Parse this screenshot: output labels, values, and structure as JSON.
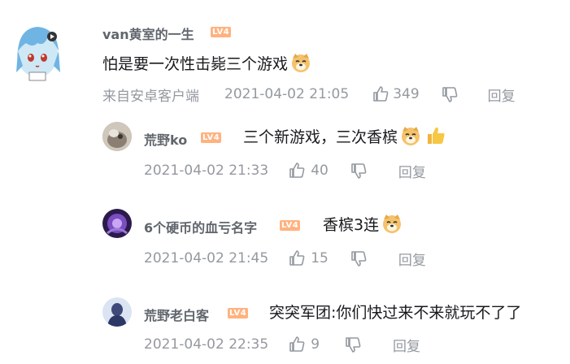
{
  "level_badge": "LV4",
  "main_comment": {
    "username": "van黄室的一生",
    "text": "怕是要一次性击毙三个游戏",
    "source": "来自安卓客户端",
    "time": "2021-04-02 21:05",
    "likes": "349",
    "reply_label": "回复",
    "emoji_icon": "doge-emoji"
  },
  "replies": [
    {
      "username": "荒野ko",
      "text": "三个新游戏，三次香槟",
      "time": "2021-04-02 21:33",
      "likes": "40",
      "reply_label": "回复",
      "emoji_icons": [
        "doge-emoji",
        "thumbs-up-emoji"
      ]
    },
    {
      "username": "6个硬币的血亏名字",
      "text": "香槟3连",
      "time": "2021-04-02 21:45",
      "likes": "15",
      "reply_label": "回复",
      "emoji_icons": [
        "doge-emoji"
      ]
    },
    {
      "username": "荒野老白客",
      "text": "突突军团:你们快过来不来就玩不了了",
      "time": "2021-04-02 22:35",
      "likes": "9",
      "reply_label": "回复",
      "emoji_icons": []
    }
  ],
  "colors": {
    "meta_gray": "#9499a0",
    "level_orange": "#ffb27f",
    "username_gray": "#61666d"
  }
}
